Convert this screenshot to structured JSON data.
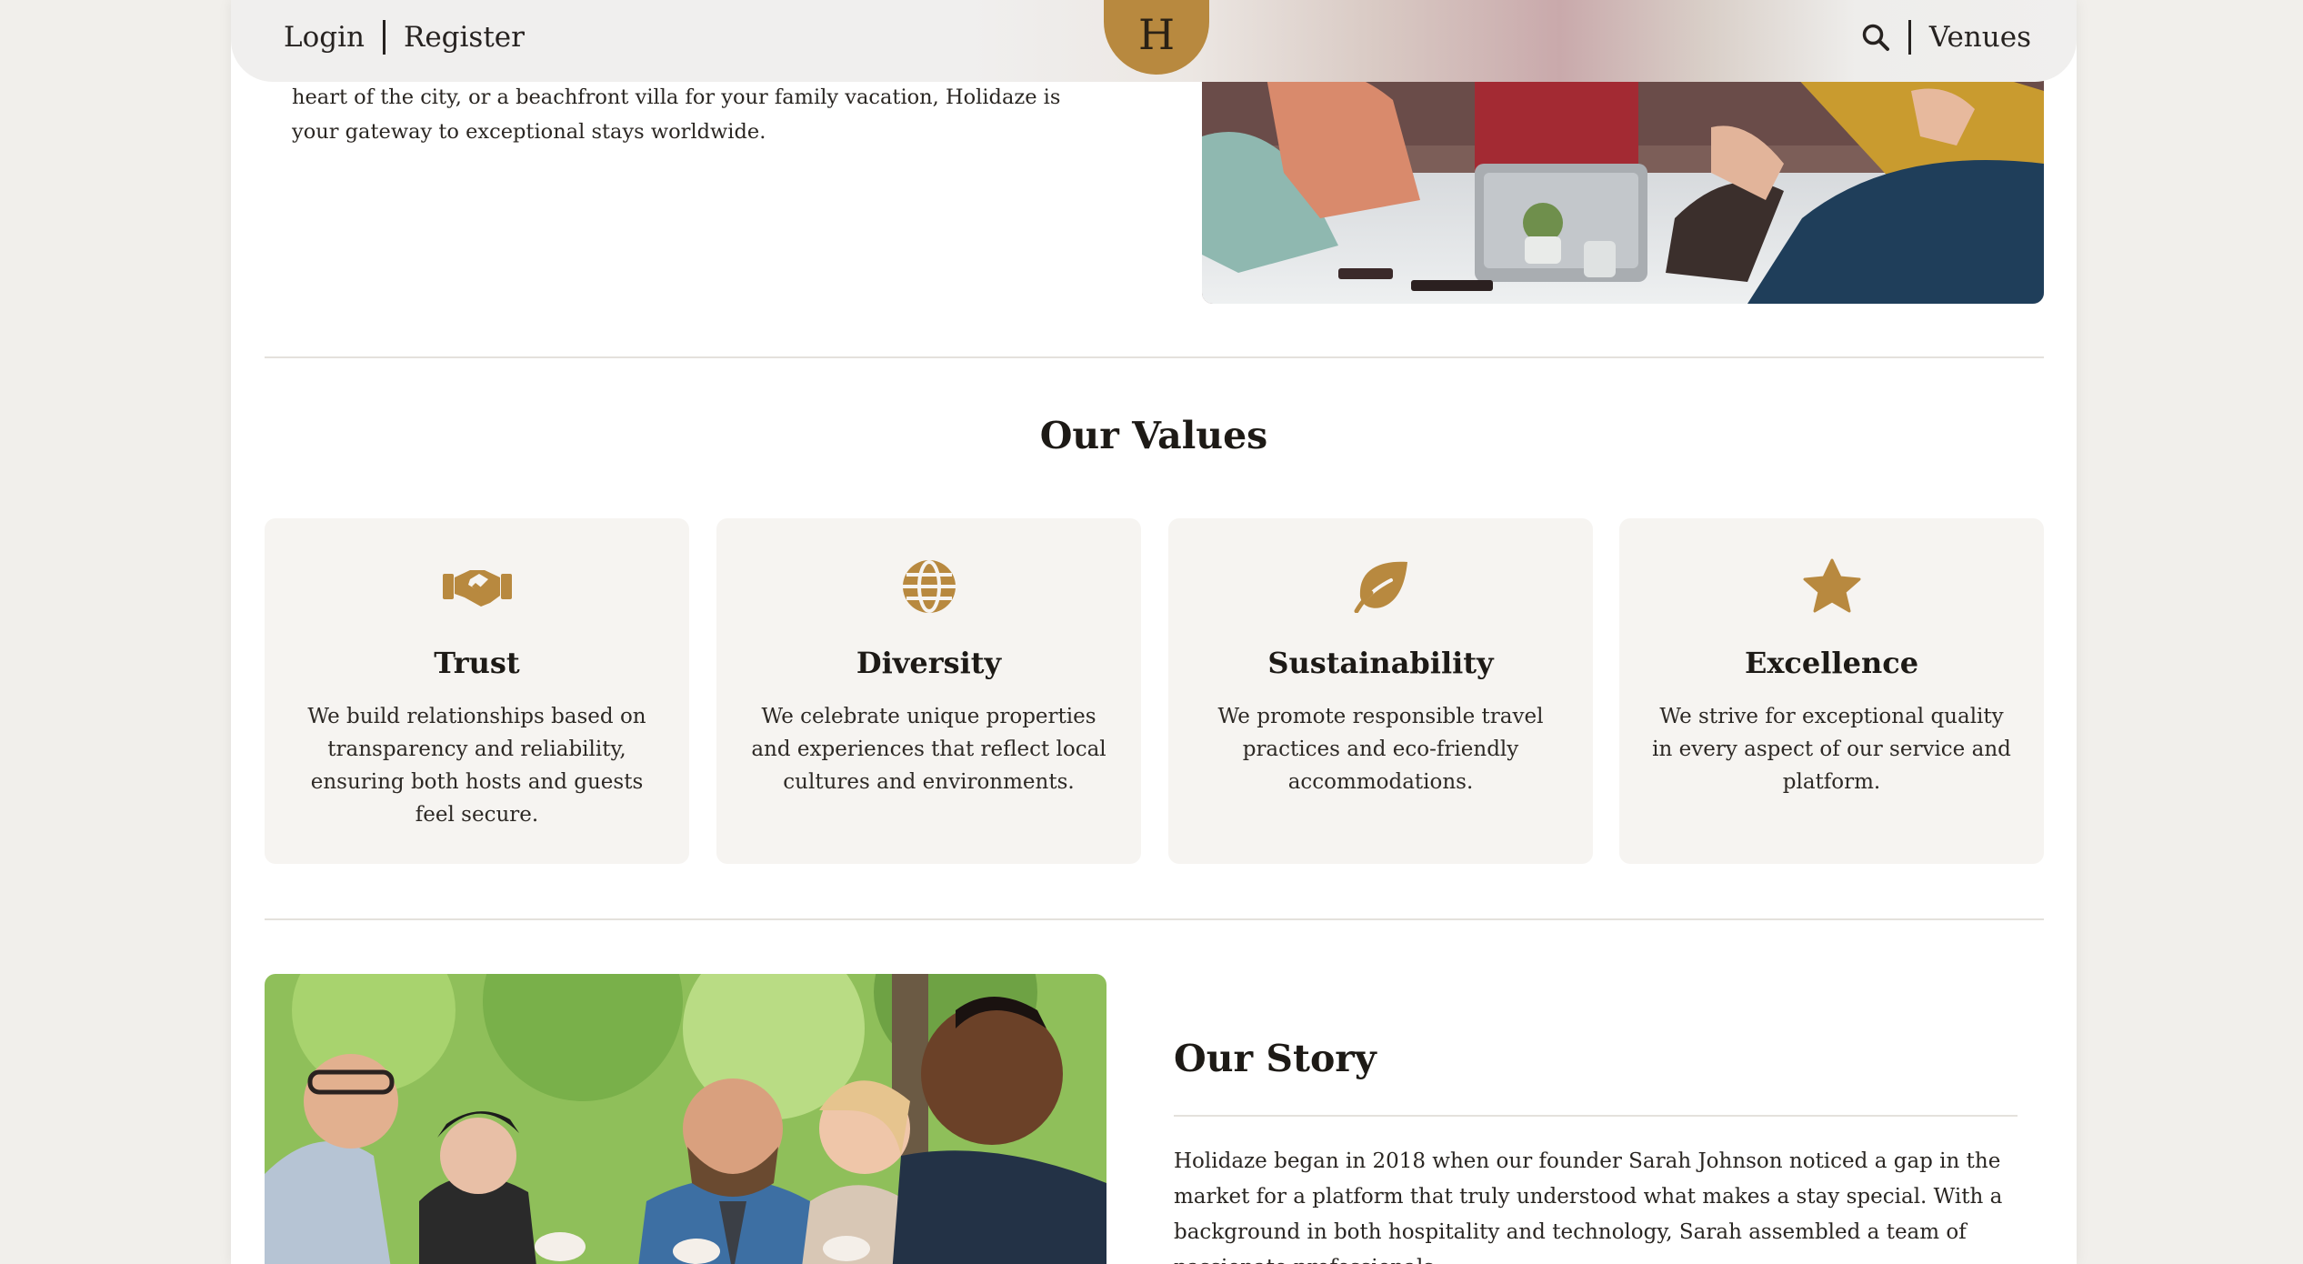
{
  "header": {
    "login_label": "Login",
    "register_label": "Register",
    "logo_letter": "H",
    "venues_label": "Venues",
    "logo_color": "#b8893f"
  },
  "intro": {
    "text": "heart of the city, or a beachfront villa for your family vacation, Holidaze is your gateway to exceptional stays worldwide."
  },
  "values": {
    "title": "Our Values",
    "accent_color": "#b8893f",
    "cards": [
      {
        "icon": "handshake-icon",
        "title": "Trust",
        "text": "We build relationships based on transparency and reliability, ensuring both hosts and guests feel secure."
      },
      {
        "icon": "globe-icon",
        "title": "Diversity",
        "text": "We celebrate unique properties and experiences that reflect local cultures and environments."
      },
      {
        "icon": "leaf-icon",
        "title": "Sustainability",
        "text": "We promote responsible travel practices and eco-friendly accommodations."
      },
      {
        "icon": "star-icon",
        "title": "Excellence",
        "text": "We strive for exceptional quality in every aspect of our service and platform."
      }
    ]
  },
  "story": {
    "title": "Our Story",
    "text": "Holidaze began in 2018 when our founder Sarah Johnson noticed a gap in the market for a platform that truly understood what makes a stay special. With a background in both hospitality and technology, Sarah assembled a team of passionate professionals"
  }
}
